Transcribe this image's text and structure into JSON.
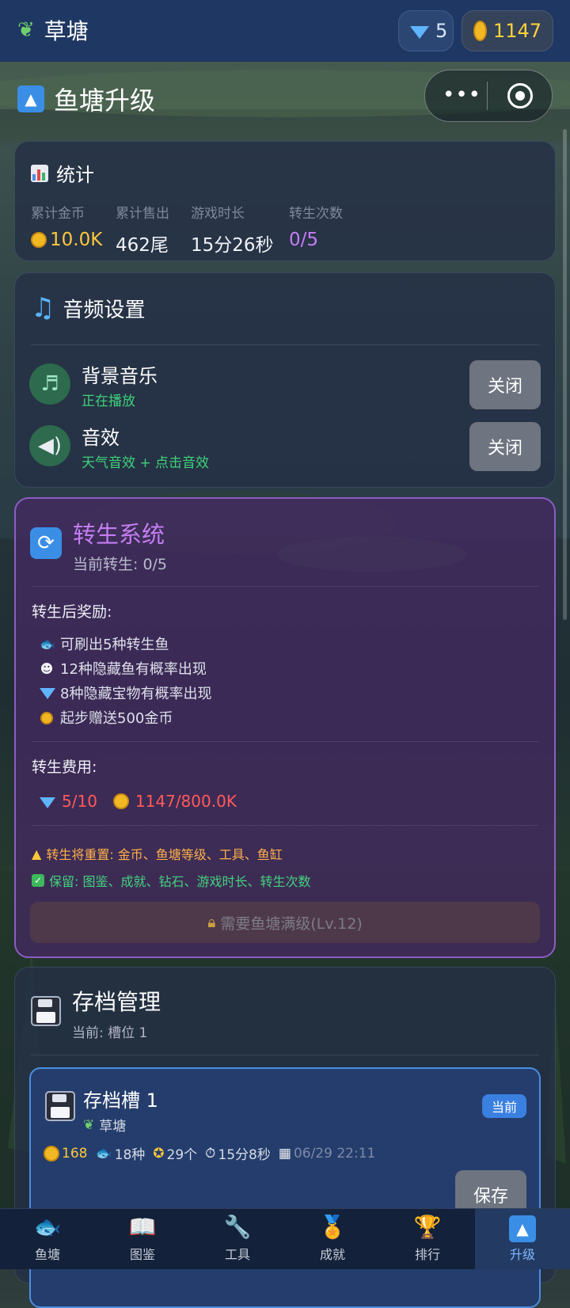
{
  "topbar": {
    "location": "草塘",
    "gems": "5",
    "coins": "1147"
  },
  "page": {
    "title": "鱼塘升级"
  },
  "stats": {
    "title": "统计",
    "items": [
      {
        "label": "累计金币",
        "value": "10.0K",
        "color": "#ffc83a"
      },
      {
        "label": "累计售出",
        "value": "462尾",
        "color": "#f2f4f8"
      },
      {
        "label": "游戏时长",
        "value": "15分26秒",
        "color": "#f2f4f8"
      },
      {
        "label": "转生次数",
        "value": "0/5",
        "color": "#c67cf5"
      }
    ]
  },
  "audio": {
    "title": "音频设置",
    "bgm": {
      "name": "背景音乐",
      "status": "正在播放",
      "button": "关闭"
    },
    "sfx": {
      "name": "音效",
      "status": "天气音效 + 点击音效",
      "button": "关闭"
    }
  },
  "rebirth": {
    "title": "转生系统",
    "current": "当前转生: 0/5",
    "rewards_label": "转生后奖励:",
    "rewards": [
      {
        "icon": "fish-icon",
        "text": "可刷出5种转生鱼"
      },
      {
        "icon": "ghost-icon",
        "text": "12种隐藏鱼有概率出现"
      },
      {
        "icon": "gem-icon",
        "text": "8种隐藏宝物有概率出现"
      },
      {
        "icon": "coin-icon",
        "text": "起步赠送500金币"
      }
    ],
    "cost_label": "转生费用:",
    "cost_gems": "5/10",
    "cost_coins": "1147/800.0K",
    "warning": "转生将重置: 金币、鱼塘等级、工具、鱼缸",
    "keep": "保留: 图鉴、成就、钻石、游戏时长、转生次数",
    "locked_button": "需要鱼塘满级(Lv.12)"
  },
  "save": {
    "title": "存档管理",
    "current": "当前: 槽位 1",
    "slot": {
      "name": "存档槽 1",
      "location": "草塘",
      "badge": "当前",
      "coins": "168",
      "fish": "18种",
      "medals": "29个",
      "time": "15分8秒",
      "date": "06/29 22:11",
      "save_button": "保存"
    }
  },
  "nav": [
    {
      "label": "鱼塘",
      "icon": "fish-icon"
    },
    {
      "label": "图鉴",
      "icon": "book-icon"
    },
    {
      "label": "工具",
      "icon": "wrench-icon"
    },
    {
      "label": "成就",
      "icon": "medal-icon"
    },
    {
      "label": "排行",
      "icon": "trophy-icon"
    },
    {
      "label": "升级",
      "icon": "upgrade-icon"
    }
  ]
}
